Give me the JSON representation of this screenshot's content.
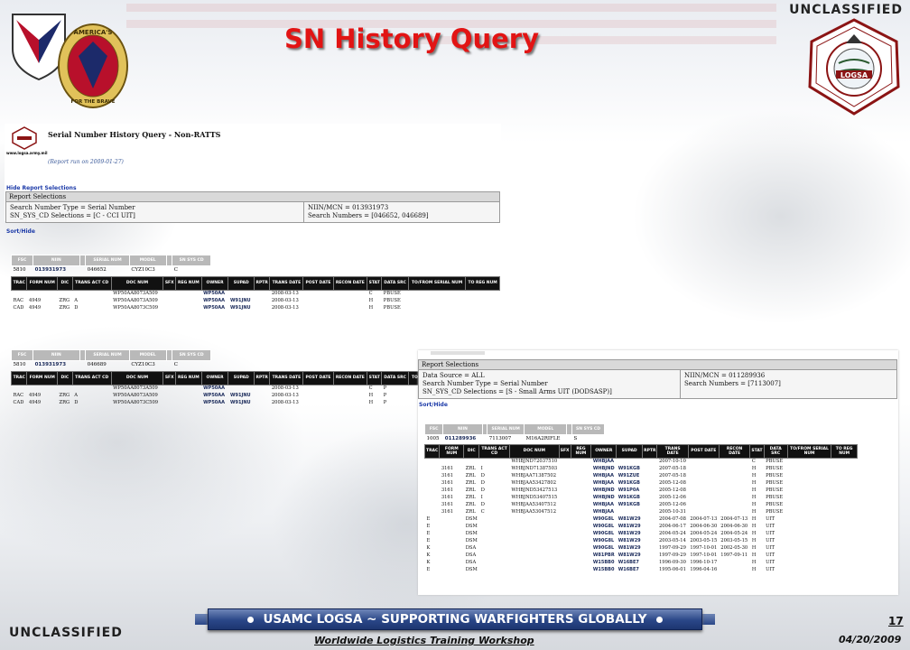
{
  "slide": {
    "classification_top": "UNCLASSIFIED",
    "classification_bottom": "UNCLASSIFIED",
    "title": "SN History Query",
    "banner": "USAMC LOGSA ~ SUPPORTING WARFIGHTERS GLOBALLY",
    "page_number": "17",
    "date": "04/20/2009",
    "workshop": "Worldwide Logistics Training Workshop",
    "left_logo_text": "AMERICA'S ARSENAL FOR THE BRAVE",
    "right_logo_text": "LOGSA"
  },
  "report1": {
    "title": "Serial Number History Query - Non-RATTS",
    "run_date": "(Report run on 2009-01-27)",
    "site_url": "www.logsa.army.mil",
    "hide_link": "Hide Report Selections",
    "selections_header": "Report Selections",
    "sel_left": [
      "Search Number Type = Serial Number",
      "SN_SYS_CD Selections = [C - CCI UIT]"
    ],
    "sel_right": [
      "NIIN/MCN = 013931973",
      "Search Numbers = [046652, 046689]"
    ],
    "sort_link": "Sort/Hide"
  },
  "summary_headers": [
    "FSC",
    "NIIN",
    "",
    "SERIAL NUM",
    "MODEL",
    "",
    "SN SYS CD"
  ],
  "detail_headers": [
    "TRAC",
    "FORM NUM",
    "DIC",
    "TRANS ACT CD",
    "DOC NUM",
    "SFX",
    "REG NUM",
    "OWNER",
    "SUPAD",
    "RPTR",
    "TRANS DATE",
    "POST DATE",
    "RECON DATE",
    "STAT",
    "DATA SRC",
    "TO/FROM SERIAL NUM",
    "TO REG NUM"
  ],
  "group1": {
    "summary": [
      "5810",
      "013931973",
      "",
      "046652",
      "CYZ10C3",
      "",
      "C"
    ],
    "rows": [
      [
        "",
        "",
        "",
        "",
        "WP50AA8073A509",
        "",
        "",
        "WP50AA",
        "",
        "",
        "2008-03-13",
        "",
        "",
        "C",
        "PBUSE",
        "",
        ""
      ],
      [
        "RAC",
        "4949",
        "ZRG",
        "A",
        "WP50AA8073A509",
        "",
        "",
        "WP50AA",
        "W91JNU",
        "",
        "2008-03-13",
        "",
        "",
        "H",
        "PBUSE",
        "",
        ""
      ],
      [
        "CAD",
        "4949",
        "ZRG",
        "D",
        "WP50AA8073C509",
        "",
        "",
        "WP50AA",
        "W91JNU",
        "",
        "2008-03-13",
        "",
        "",
        "H",
        "PBUSE",
        "",
        ""
      ]
    ]
  },
  "group2": {
    "summary": [
      "5810",
      "013931973",
      "",
      "046689",
      "CYZ10C3",
      "",
      "C"
    ],
    "rows": [
      [
        "",
        "",
        "",
        "",
        "WP50AA8073A509",
        "",
        "",
        "WP50AA",
        "",
        "",
        "2008-03-13",
        "",
        "",
        "C",
        "P",
        "",
        ""
      ],
      [
        "RAC",
        "4949",
        "ZRG",
        "A",
        "WP50AA8073A509",
        "",
        "",
        "WP50AA",
        "W91JNU",
        "",
        "2008-03-13",
        "",
        "",
        "H",
        "P",
        "",
        ""
      ],
      [
        "CAD",
        "4949",
        "ZRG",
        "D",
        "WP50AA8073C509",
        "",
        "",
        "WP50AA",
        "W91JNU",
        "",
        "2008-03-13",
        "",
        "",
        "H",
        "P",
        "",
        ""
      ]
    ]
  },
  "report2": {
    "selections_header": "Report Selections",
    "sel_left": [
      "Data Source = ALL",
      "Search Number Type = Serial Number",
      "SN_SYS_CD Selections = [S - Small Arms UIT (DODSASP)]"
    ],
    "sel_right": [
      "NIIN/MCN = 011289936",
      "Search Numbers = [7113007]"
    ],
    "sort_link": "Sort/Hide",
    "summary": [
      "1005",
      "011289936",
      "",
      "7113007",
      "M16A2RIFLE",
      "",
      "S"
    ],
    "rows": [
      [
        "",
        "",
        "",
        "",
        "WHBJND72037510",
        "",
        "",
        "WHBJAA",
        "",
        "",
        "2007-10-10",
        "",
        "",
        "C",
        "PBUSE",
        "",
        ""
      ],
      [
        "",
        "3161",
        "ZRL",
        "I",
        "WHBJND71387503",
        "",
        "",
        "WHBJND",
        "W91KGB",
        "",
        "2007-05-18",
        "",
        "",
        "H",
        "PBUSE",
        "",
        ""
      ],
      [
        "",
        "3161",
        "ZRL",
        "D",
        "WHBJAA71387502",
        "",
        "",
        "WHBJAA",
        "W91ZUE",
        "",
        "2007-05-18",
        "",
        "",
        "H",
        "PBUSE",
        "",
        ""
      ],
      [
        "",
        "3161",
        "ZRL",
        "D",
        "WHBJAA53427802",
        "",
        "",
        "WHBJAA",
        "W91KGB",
        "",
        "2005-12-08",
        "",
        "",
        "H",
        "PBUSE",
        "",
        ""
      ],
      [
        "",
        "3161",
        "ZRL",
        "D",
        "WHBJND53427513",
        "",
        "",
        "WHBJND",
        "W91P0A",
        "",
        "2005-12-08",
        "",
        "",
        "H",
        "PBUSE",
        "",
        ""
      ],
      [
        "",
        "3161",
        "ZRL",
        "I",
        "WHBJND53407515",
        "",
        "",
        "WHBJND",
        "W91KGB",
        "",
        "2005-12-06",
        "",
        "",
        "H",
        "PBUSE",
        "",
        ""
      ],
      [
        "",
        "3161",
        "ZRL",
        "D",
        "WHBJAA53407512",
        "",
        "",
        "WHBJAA",
        "W91KGB",
        "",
        "2005-12-06",
        "",
        "",
        "H",
        "PBUSE",
        "",
        ""
      ],
      [
        "",
        "3161",
        "ZRL",
        "C",
        "WHBJAA53047512",
        "",
        "",
        "WHBJAA",
        "",
        "",
        "2005-10-31",
        "",
        "",
        "H",
        "PBUSE",
        "",
        ""
      ],
      [
        "E",
        "",
        "DSM",
        "",
        "",
        "",
        "",
        "W90G8L",
        "W81W29",
        "",
        "2004-07-08",
        "2004-07-13",
        "2004-07-13",
        "H",
        "UIT",
        "",
        ""
      ],
      [
        "E",
        "",
        "DSM",
        "",
        "",
        "",
        "",
        "W90G8L",
        "W81W29",
        "",
        "2004-06-17",
        "2004-06-30",
        "2004-06-30",
        "H",
        "UIT",
        "",
        ""
      ],
      [
        "E",
        "",
        "DSM",
        "",
        "",
        "",
        "",
        "W90G8L",
        "W81W29",
        "",
        "2004-05-24",
        "2004-05-24",
        "2004-05-24",
        "H",
        "UIT",
        "",
        ""
      ],
      [
        "E",
        "",
        "DSM",
        "",
        "",
        "",
        "",
        "W90G8L",
        "W81W29",
        "",
        "2003-05-14",
        "2003-05-15",
        "2003-05-15",
        "H",
        "UIT",
        "",
        ""
      ],
      [
        "K",
        "",
        "DSA",
        "",
        "",
        "",
        "",
        "W90G8L",
        "W81W29",
        "",
        "1997-09-29",
        "1997-10-01",
        "2002-05-30",
        "H",
        "UIT",
        "",
        ""
      ],
      [
        "K",
        "",
        "DSA",
        "",
        "",
        "",
        "",
        "W81PBR",
        "W81W29",
        "",
        "1997-09-29",
        "1997-10-01",
        "1997-09-11",
        "H",
        "UIT",
        "",
        ""
      ],
      [
        "K",
        "",
        "DSA",
        "",
        "",
        "",
        "",
        "W15BB0",
        "W16BE7",
        "",
        "1996-09-30",
        "1996-10-17",
        "",
        "H",
        "UIT",
        "",
        ""
      ],
      [
        "E",
        "",
        "DSM",
        "",
        "",
        "",
        "",
        "W15BB0",
        "W16BE7",
        "",
        "1995-06-01",
        "1996-04-16",
        "",
        "H",
        "UIT",
        "",
        ""
      ]
    ]
  }
}
